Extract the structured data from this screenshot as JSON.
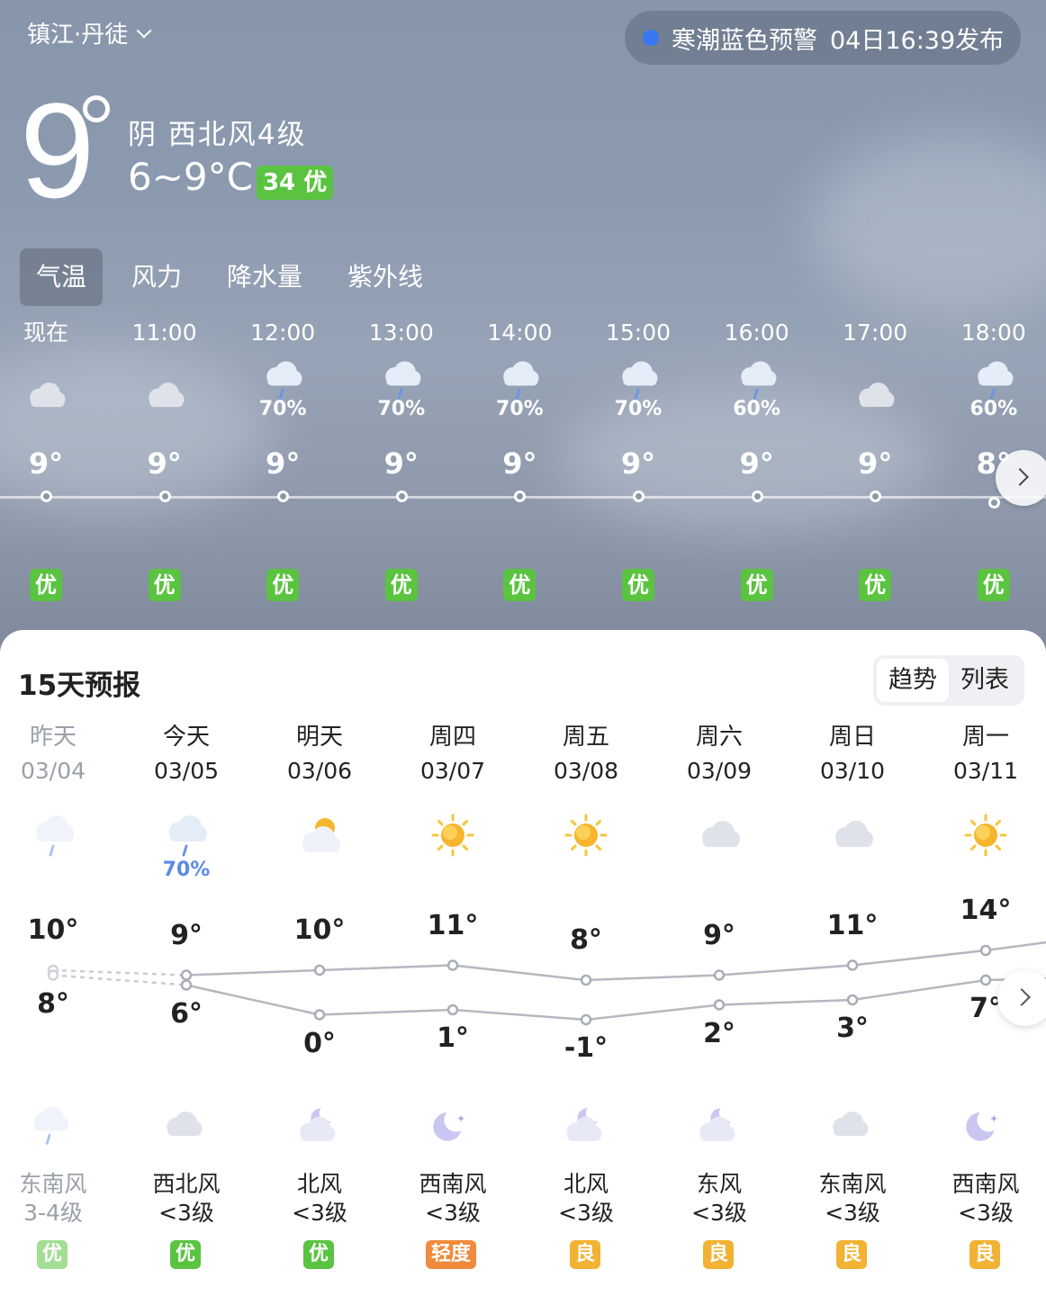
{
  "header": {
    "location": "镇江·丹徒",
    "alert": {
      "text": "寒潮蓝色预警",
      "time": "04日16:39发布",
      "dot_color": "#3a78f2"
    }
  },
  "current": {
    "temp": "9",
    "condition": "阴  西北风4级",
    "range": "6~9°C",
    "aqi": "34 优",
    "aqi_color": "#5ac340"
  },
  "tabs": [
    {
      "label": "气温",
      "active": true
    },
    {
      "label": "风力",
      "active": false
    },
    {
      "label": "降水量",
      "active": false
    },
    {
      "label": "紫外线",
      "active": false
    }
  ],
  "hourly": [
    {
      "label": "现在",
      "icon": "cloudy-icon",
      "precip": "",
      "temp": "9°",
      "aqi": "优"
    },
    {
      "label": "11:00",
      "icon": "cloudy-icon",
      "precip": "",
      "temp": "9°",
      "aqi": "优"
    },
    {
      "label": "12:00",
      "icon": "rain-icon",
      "precip": "70%",
      "temp": "9°",
      "aqi": "优"
    },
    {
      "label": "13:00",
      "icon": "rain-icon",
      "precip": "70%",
      "temp": "9°",
      "aqi": "优"
    },
    {
      "label": "14:00",
      "icon": "rain-icon",
      "precip": "70%",
      "temp": "9°",
      "aqi": "优"
    },
    {
      "label": "15:00",
      "icon": "rain-icon",
      "precip": "70%",
      "temp": "9°",
      "aqi": "优"
    },
    {
      "label": "16:00",
      "icon": "rain-icon",
      "precip": "60%",
      "temp": "9°",
      "aqi": "优"
    },
    {
      "label": "17:00",
      "icon": "cloudy-icon",
      "precip": "",
      "temp": "9°",
      "aqi": "优"
    },
    {
      "label": "18:00",
      "icon": "rain-icon",
      "precip": "60%",
      "temp": "8°",
      "aqi": "优"
    }
  ],
  "forecast": {
    "title": "15天预报",
    "toggle": [
      "趋势",
      "列表"
    ],
    "days": [
      {
        "name": "昨天",
        "date": "03/04",
        "day_icon": "rain-icon",
        "precip": "",
        "high": "10°",
        "low": "8°",
        "high_val": 10,
        "low_val": 8,
        "night_icon": "rain-icon",
        "wind_dir": "东南风",
        "wind_lvl": "3-4级",
        "aqi": "优",
        "aqi_color": "#5ac340",
        "past": true
      },
      {
        "name": "今天",
        "date": "03/05",
        "day_icon": "rain-icon",
        "precip": "70%",
        "high": "9°",
        "low": "6°",
        "high_val": 9,
        "low_val": 6,
        "night_icon": "cloudy-icon",
        "wind_dir": "西北风",
        "wind_lvl": "<3级",
        "aqi": "优",
        "aqi_color": "#5ac340",
        "past": false
      },
      {
        "name": "明天",
        "date": "03/06",
        "day_icon": "partly-sunny-icon",
        "precip": "",
        "high": "10°",
        "low": "0°",
        "high_val": 10,
        "low_val": 0,
        "night_icon": "partly-moon-icon",
        "wind_dir": "北风",
        "wind_lvl": "<3级",
        "aqi": "优",
        "aqi_color": "#5ac340",
        "past": false
      },
      {
        "name": "周四",
        "date": "03/07",
        "day_icon": "sun-icon",
        "precip": "",
        "high": "11°",
        "low": "1°",
        "high_val": 11,
        "low_val": 1,
        "night_icon": "moon-icon",
        "wind_dir": "西南风",
        "wind_lvl": "<3级",
        "aqi": "轻度",
        "aqi_color": "#f08a3c",
        "past": false
      },
      {
        "name": "周五",
        "date": "03/08",
        "day_icon": "sun-icon",
        "precip": "",
        "high": "8°",
        "low": "-1°",
        "high_val": 8,
        "low_val": -1,
        "night_icon": "partly-moon-icon",
        "wind_dir": "北风",
        "wind_lvl": "<3级",
        "aqi": "良",
        "aqi_color": "#f2b233",
        "past": false
      },
      {
        "name": "周六",
        "date": "03/09",
        "day_icon": "cloudy-icon",
        "precip": "",
        "high": "9°",
        "low": "2°",
        "high_val": 9,
        "low_val": 2,
        "night_icon": "partly-moon-icon",
        "wind_dir": "东风",
        "wind_lvl": "<3级",
        "aqi": "良",
        "aqi_color": "#f2b233",
        "past": false
      },
      {
        "name": "周日",
        "date": "03/10",
        "day_icon": "cloudy-icon",
        "precip": "",
        "high": "11°",
        "low": "3°",
        "high_val": 11,
        "low_val": 3,
        "night_icon": "cloudy-icon",
        "wind_dir": "东南风",
        "wind_lvl": "<3级",
        "aqi": "良",
        "aqi_color": "#f2b233",
        "past": false
      },
      {
        "name": "周一",
        "date": "03/11",
        "day_icon": "sun-icon",
        "precip": "",
        "high": "14°",
        "low": "7°",
        "high_val": 14,
        "low_val": 7,
        "night_icon": "moon-icon",
        "wind_dir": "西南风",
        "wind_lvl": "<3级",
        "aqi": "良",
        "aqi_color": "#f2b233",
        "past": false
      }
    ]
  }
}
